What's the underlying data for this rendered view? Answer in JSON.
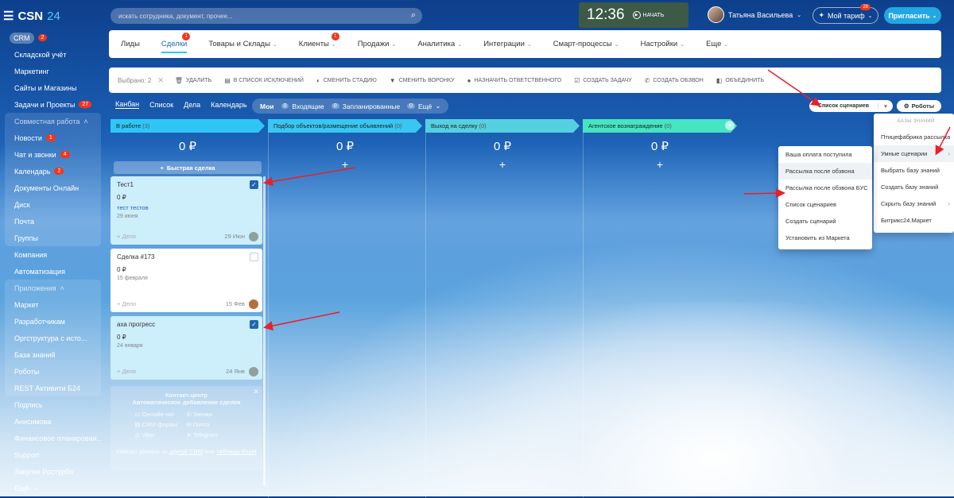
{
  "app": {
    "logo_text": "CSN",
    "logo_num": "24"
  },
  "search": {
    "placeholder": "искать сотрудника, документ, прочее..."
  },
  "clock": {
    "time": "12:36",
    "start_label": "НАЧАТЬ"
  },
  "user": {
    "name": "Татьяна Васильева"
  },
  "plan": {
    "label": "Мой тариф",
    "badge": "28"
  },
  "invite": {
    "label": "Пригласить"
  },
  "sidebar": {
    "items": [
      {
        "label": "CRM",
        "count": "2"
      },
      {
        "label": "Складской учёт"
      },
      {
        "label": "Маркетинг"
      },
      {
        "label": "Сайты и Магазины"
      },
      {
        "label": "Задачи и Проекты",
        "count": "27"
      },
      {
        "label": "Совместная работа"
      },
      {
        "label": "Новости",
        "count": "1"
      },
      {
        "label": "Чат и звонки",
        "count": "4"
      },
      {
        "label": "Календарь",
        "count": "2"
      },
      {
        "label": "Документы Онлайн"
      },
      {
        "label": "Диск"
      },
      {
        "label": "Почта"
      },
      {
        "label": "Группы"
      },
      {
        "label": "Компания"
      },
      {
        "label": "Автоматизация"
      },
      {
        "label": "Приложения"
      },
      {
        "label": "Маркет"
      },
      {
        "label": "Разработчикам"
      },
      {
        "label": "Оргструктура с исто..."
      },
      {
        "label": "База знаний"
      },
      {
        "label": "Роботы"
      },
      {
        "label": "REST Активити Б24"
      },
      {
        "label": "Подпись"
      },
      {
        "label": "Анисимова"
      },
      {
        "label": "Финансовое планирован..."
      },
      {
        "label": "Support"
      },
      {
        "label": "Закупки Ростурбо"
      },
      {
        "label": "Ещё"
      }
    ]
  },
  "tabs": [
    {
      "label": "Лиды"
    },
    {
      "label": "Сделки",
      "badge": "1"
    },
    {
      "label": "Товары и Склады"
    },
    {
      "label": "Клиенты",
      "badge": "1"
    },
    {
      "label": "Продажи"
    },
    {
      "label": "Аналитика"
    },
    {
      "label": "Интеграции"
    },
    {
      "label": "Смарт-процессы"
    },
    {
      "label": "Настройки"
    },
    {
      "label": "Еще"
    }
  ],
  "actionbar": {
    "selected": "Выбрано: 2",
    "actions": [
      {
        "label": "удалить",
        "icon": "trash-icon"
      },
      {
        "label": "в список исключений",
        "icon": "list-icon"
      },
      {
        "label": "сменить стадию",
        "icon": "stage-icon"
      },
      {
        "label": "сменить воронку",
        "icon": "funnel-icon"
      },
      {
        "label": "назначить ответственного",
        "icon": "user-icon"
      },
      {
        "label": "создать задачу",
        "icon": "task-icon"
      },
      {
        "label": "создать обзвон",
        "icon": "phone-icon"
      },
      {
        "label": "объединить",
        "icon": "merge-icon"
      }
    ]
  },
  "views": [
    {
      "label": "Канбан"
    },
    {
      "label": "Список"
    },
    {
      "label": "Дела"
    },
    {
      "label": "Календарь"
    }
  ],
  "filter": {
    "label": "Мои",
    "incoming": {
      "count": "0",
      "label": "Входящие"
    },
    "scheduled": {
      "count": "0",
      "label": "Запланированные"
    },
    "more": {
      "count": "0",
      "label": "Ещё"
    }
  },
  "buttons": {
    "scenarios": "Список сценариев",
    "robots": "Роботы"
  },
  "columns": [
    {
      "title": "В работе",
      "count": "(3)",
      "sum": "0 ₽",
      "color": "#2fc6f6"
    },
    {
      "title": "Подбор объектов/размещение объявлений",
      "count": "(0)",
      "sum": "0 ₽",
      "color": "#39c6f0"
    },
    {
      "title": "Выход на сделку",
      "count": "(0)",
      "sum": "0 ₽",
      "color": "#55d0e0"
    },
    {
      "title": "Агентское вознаграждение",
      "count": "(0)",
      "sum": "0 ₽",
      "color": "#47e4c2"
    }
  ],
  "quick_deal": "Быстрая сделка",
  "cards": [
    {
      "title": "Тест1",
      "price": "0 ₽",
      "client": "тест тестов",
      "date": "29 июня",
      "deal": "+ Дело",
      "cdate": "29 Июн"
    },
    {
      "title": "Сделка #173",
      "price": "0 ₽",
      "client": "",
      "date": "15 февраля",
      "deal": "+ Дело",
      "cdate": "15 Фев"
    },
    {
      "title": "аха прогресс",
      "price": "0 ₽",
      "client": "",
      "date": "24 января",
      "deal": "+ Дело",
      "cdate": "24 Янв"
    }
  ],
  "contact_center": {
    "title": "Контакт-центр",
    "subtitle": "Автоматическое добавление сделок",
    "channels": [
      "Онлайн-чат",
      "Звонки",
      "CRM-формы",
      "Почта",
      "Viber",
      "Telegram"
    ],
    "import_prefix": "Импорт данных из",
    "import_link1": "другой CRM",
    "import_mid": "или",
    "import_link2": "таблицы Excel"
  },
  "right_menu": {
    "header": "БАЗЫ ЗНАНИЙ",
    "items": [
      "Птицефабрика рассылка",
      "Умные сценарии",
      "Выбрать базу знаний",
      "Создать базу знаний",
      "Скрыть базу знаний",
      "Битрикс24.Маркет"
    ]
  },
  "sub_menu": {
    "items": [
      "Ваша оплата поступила",
      "Рассылка после обзвона",
      "Рассылка после обзвона БУС",
      "Список сценариев",
      "Создать сценарий",
      "Установить из Маркета"
    ]
  }
}
